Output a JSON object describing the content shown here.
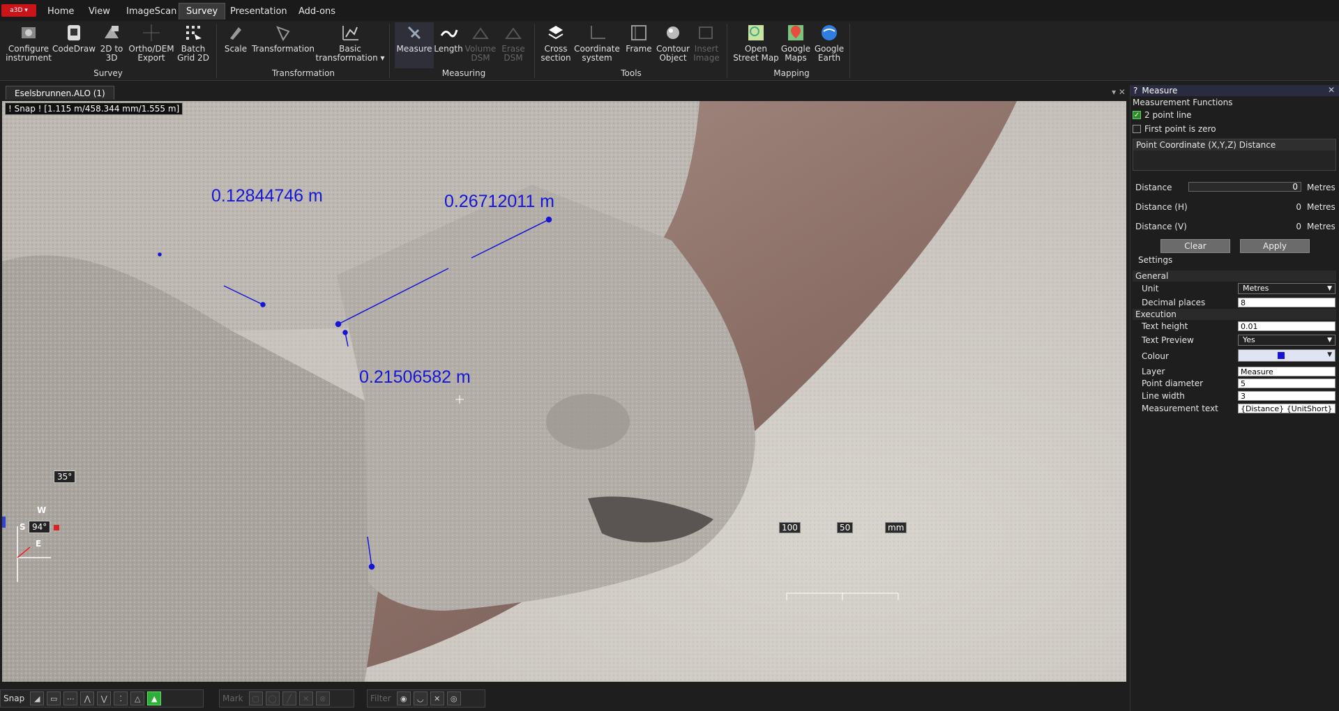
{
  "app_button": "a3D ▾",
  "menu_tabs": [
    "Home",
    "View",
    "ImageScan",
    "Survey",
    "Presentation",
    "Add-ons"
  ],
  "active_tab": "Survey",
  "ribbon": {
    "buttons": [
      {
        "label": "Configure\ninstrument",
        "icon": "configure-instrument-icon"
      },
      {
        "label": "CodeDraw",
        "icon": "codedraw-icon"
      },
      {
        "label": "2D to\n3D",
        "icon": "2d-to-3d-icon"
      },
      {
        "label": "Ortho/DEM\nExport",
        "icon": "ortho-dem-export-icon"
      },
      {
        "label": "Batch\nGrid 2D",
        "icon": "batch-grid-icon"
      },
      {
        "label": "Scale",
        "icon": "scale-icon"
      },
      {
        "label": "Transformation",
        "icon": "transformation-icon"
      },
      {
        "label": "Basic\ntransformation ▾",
        "icon": "basic-transformation-icon"
      },
      {
        "label": "Measure",
        "icon": "measure-icon"
      },
      {
        "label": "Length",
        "icon": "length-icon"
      },
      {
        "label": "Volume\nDSM",
        "icon": "volume-dsm-icon"
      },
      {
        "label": "Erase\nDSM",
        "icon": "erase-dsm-icon"
      },
      {
        "label": "Cross\nsection",
        "icon": "cross-section-icon"
      },
      {
        "label": "Coordinate\nsystem",
        "icon": "coordinate-system-icon"
      },
      {
        "label": "Frame",
        "icon": "frame-icon"
      },
      {
        "label": "Contour\nObject",
        "icon": "contour-object-icon"
      },
      {
        "label": "Insert\nImage",
        "icon": "insert-image-icon"
      },
      {
        "label": "Open\nStreet Map",
        "icon": "open-street-map-icon"
      },
      {
        "label": "Google\nMaps",
        "icon": "google-maps-icon"
      },
      {
        "label": "Google\nEarth",
        "icon": "google-earth-icon"
      }
    ],
    "groups": [
      "Survey",
      "Transformation",
      "Measuring",
      "Tools",
      "Mapping"
    ]
  },
  "document_tab": "Eselsbrunnen.ALO (1)",
  "doc_controls": "▾ ✕",
  "viewport": {
    "snap_info": "! Snap ! [1.115 m/458.344 mm/1.555 m]",
    "measurements": [
      "0.12844746 m",
      "0.26712011 m",
      "0.21506582 m"
    ],
    "angle_top": "35°",
    "angle_bottom": "94°",
    "compass": {
      "w": "W",
      "s": "S",
      "e": "E"
    },
    "scale_labels": [
      "100",
      "50",
      "mm"
    ],
    "measure_color": "#1515d8"
  },
  "bottom_bar": {
    "snap": "Snap",
    "mark": "Mark",
    "filter": "Filter"
  },
  "panel": {
    "title": "Measure",
    "title_prefix": "?",
    "section_functions": "Measurement Functions",
    "two_point_line": "2 point line",
    "two_point_checked": true,
    "first_point_zero": "First point is zero",
    "first_point_checked": false,
    "coord_header": "Point Coordinate (X,Y,Z) Distance",
    "distance_label": "Distance",
    "distance_value": "0",
    "distance_h_label": "Distance (H)",
    "distance_h_value": "0",
    "distance_v_label": "Distance (V)",
    "distance_v_value": "0",
    "unit_text": "Metres",
    "clear_btn": "Clear",
    "apply_btn": "Apply",
    "settings": "Settings",
    "general": "General",
    "unit_label": "Unit",
    "unit_value": "Metres",
    "decimal_label": "Decimal places",
    "decimal_value": "8",
    "execution": "Execution",
    "text_height_label": "Text height",
    "text_height_value": "0.01",
    "text_preview_label": "Text Preview",
    "text_preview_value": "Yes",
    "colour_label": "Colour",
    "colour_value": "#1515d8",
    "layer_label": "Layer",
    "layer_value": "Measure",
    "point_diameter_label": "Point diameter",
    "point_diameter_value": "5",
    "line_width_label": "Line width",
    "line_width_value": "3",
    "measurement_text_label": "Measurement text",
    "measurement_text_value": "{Distance} {UnitShort}"
  }
}
